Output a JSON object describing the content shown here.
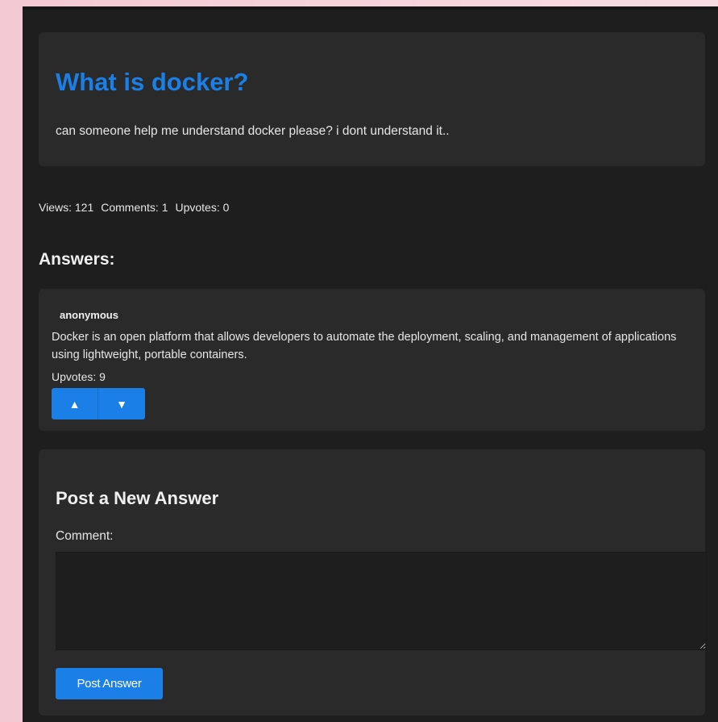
{
  "question": {
    "title": "What is docker?",
    "body": "can someone help me understand docker please? i dont understand it.."
  },
  "stats": {
    "views": "Views: 121",
    "comments": "Comments: 1",
    "upvotes": "Upvotes: 0"
  },
  "answers_heading": "Answers:",
  "answers": [
    {
      "author": "anonymous",
      "text": "Docker is an open platform that allows developers to automate the deployment, scaling, and management of applications using lightweight, portable containers.",
      "upvotes": "Upvotes: 9",
      "upvote_symbol": "▲",
      "downvote_symbol": "▼"
    }
  ],
  "post_form": {
    "heading": "Post a New Answer",
    "comment_label": "Comment:",
    "comment_value": "",
    "submit_label": "Post Answer"
  },
  "colors": {
    "accent": "#1a7fe6",
    "background": "#1e1e1e",
    "card": "#2a2a2a"
  }
}
